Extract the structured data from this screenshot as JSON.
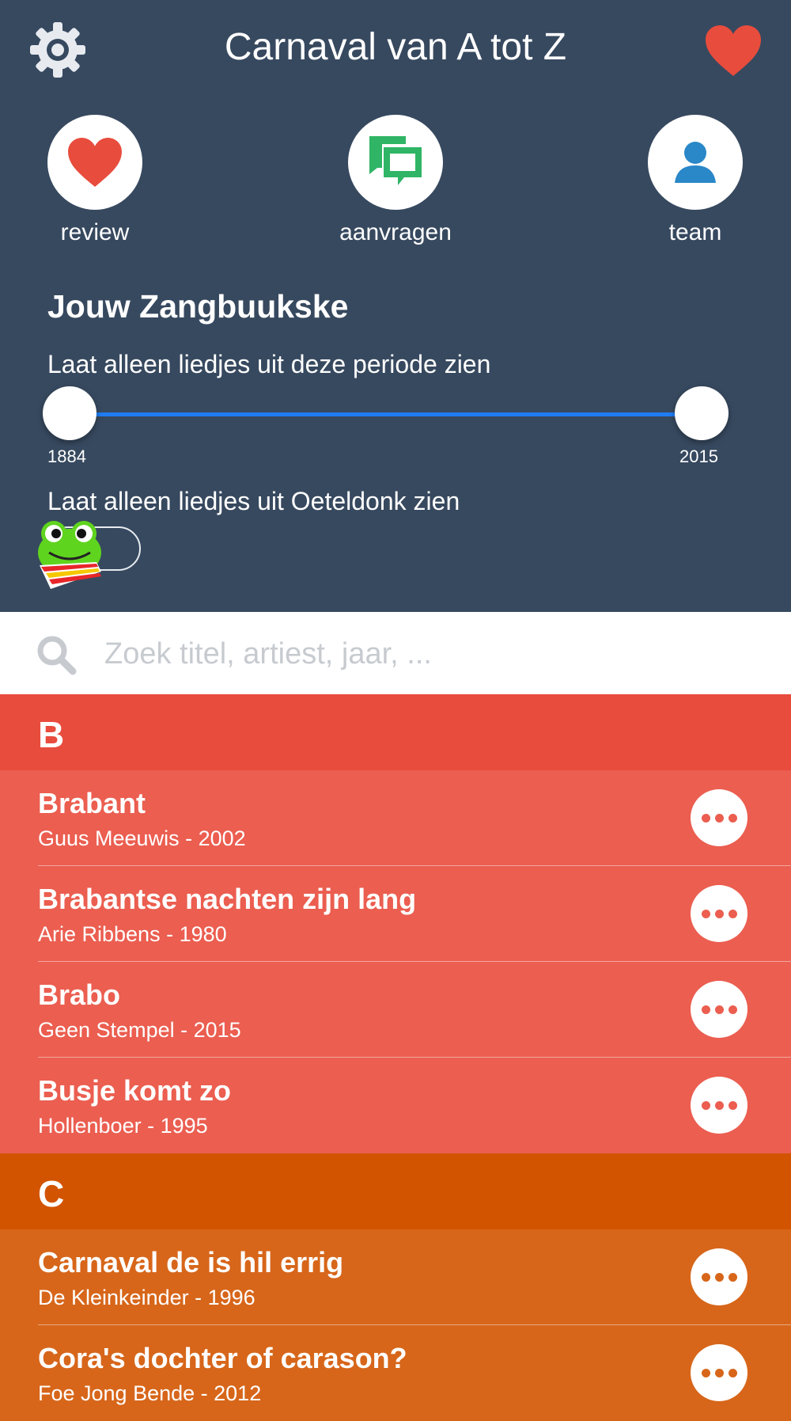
{
  "header": {
    "title": "Carnaval van A tot Z",
    "settings_icon": "gear-icon",
    "favorite_icon": "heart-icon"
  },
  "actions": [
    {
      "label": "review",
      "icon": "heart-icon"
    },
    {
      "label": "aanvragen",
      "icon": "chat-bubbles-icon"
    },
    {
      "label": "team",
      "icon": "person-icon"
    }
  ],
  "filters": {
    "section_title": "Jouw Zangbuukske",
    "period_label": "Laat alleen liedjes uit deze periode zien",
    "period_min": "1884",
    "period_max": "2015",
    "oeteldonk_label": "Laat alleen liedjes uit Oeteldonk zien",
    "oeteldonk_enabled": false
  },
  "search": {
    "placeholder": "Zoek titel, artiest, jaar, ..."
  },
  "colors": {
    "header_bg": "#37495f",
    "accent_blue": "#1f7cf5",
    "heart_red": "#e84c3d",
    "chat_green": "#2fb565",
    "person_blue": "#2a87c8",
    "group_b_header": "#e84c3d",
    "group_b_row": "#eb5e50",
    "group_c_header": "#d25400",
    "group_c_row": "#d7661a"
  },
  "groups": [
    {
      "letter": "B",
      "songs": [
        {
          "title": "Brabant",
          "subtitle": "Guus Meeuwis - 2002"
        },
        {
          "title": "Brabantse nachten zijn lang",
          "subtitle": "Arie Ribbens - 1980"
        },
        {
          "title": "Brabo",
          "subtitle": "Geen Stempel - 2015"
        },
        {
          "title": "Busje komt zo",
          "subtitle": "Hollenboer - 1995"
        }
      ]
    },
    {
      "letter": "C",
      "songs": [
        {
          "title": "Carnaval de is hil errig",
          "subtitle": "De Kleinkeinder - 1996"
        },
        {
          "title": "Cora's dochter of carason?",
          "subtitle": "Foe Jong Bende - 2012"
        }
      ]
    }
  ]
}
